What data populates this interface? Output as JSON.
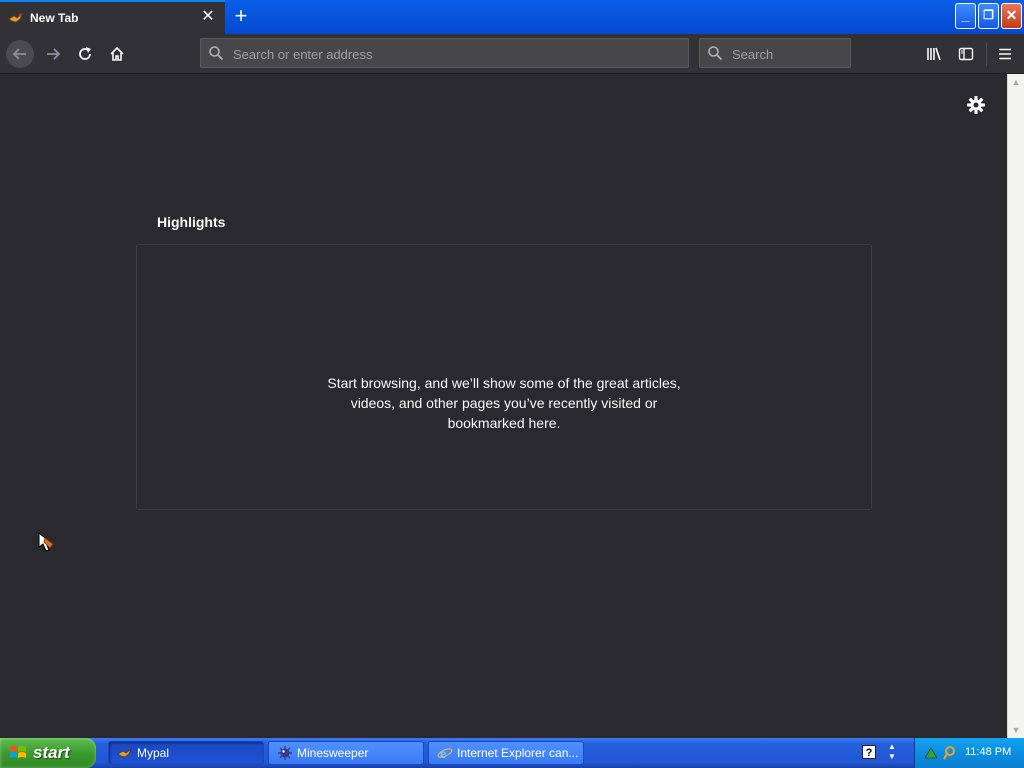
{
  "browser": {
    "tab": {
      "title": "New Tab",
      "close_glyph": "✕",
      "favicon": "mypal-icon"
    },
    "new_tab_glyph": "+",
    "window_buttons": {
      "minimize": "_",
      "restore": "❐",
      "close": "✕"
    },
    "urlbar": {
      "placeholder": "Search or enter address",
      "value": ""
    },
    "searchbar": {
      "placeholder": "Search",
      "value": ""
    }
  },
  "content": {
    "highlights_title": "Highlights",
    "empty_message_lines": [
      "Start browsing, and we’ll show some of the great articles,",
      "videos, and other pages you’ve recently visited or",
      "bookmarked here."
    ]
  },
  "taskbar": {
    "start_label": "start",
    "tasks": [
      {
        "label": "Mypal",
        "icon": "mypal-icon",
        "active": true
      },
      {
        "label": "Minesweeper",
        "icon": "minesweeper-icon",
        "active": false
      },
      {
        "label": "Internet Explorer can...",
        "icon": "ie-icon",
        "active": false
      }
    ],
    "help_glyph": "?",
    "clock": "11:48 PM"
  },
  "colors": {
    "content_bg": "#2a2a2e",
    "toolbar_bg": "#323236",
    "tab_accent": "#0a84ff",
    "xp_titlebar": "#0449d0",
    "start_green": "#3c9a2f",
    "tray_blue": "#0c8ee0"
  }
}
